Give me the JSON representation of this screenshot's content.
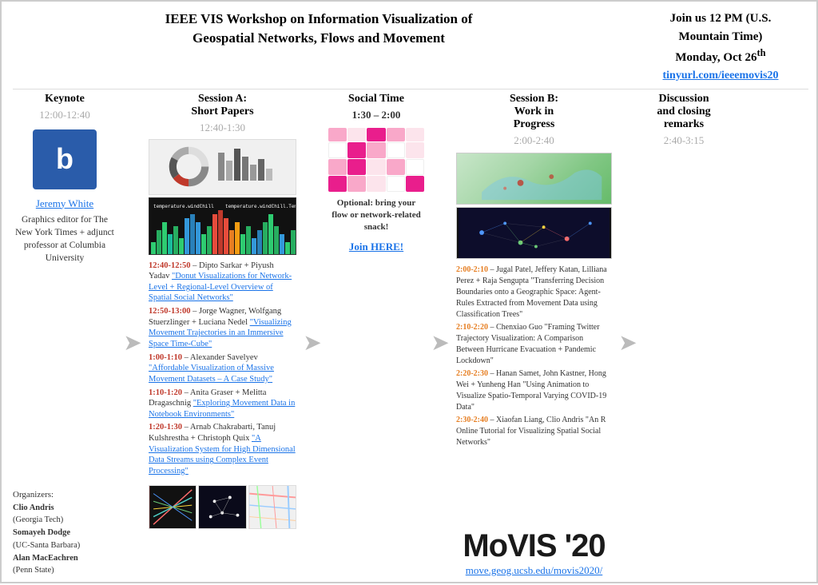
{
  "header": {
    "title_line1": "IEEE VIS Workshop on Information Visualization of",
    "title_line2": "Geospatial Networks, Flows and Movement",
    "join_label": "Join us 12 PM (U.S.",
    "join_time": "Mountain Time)",
    "join_day": "Monday, Oct 26",
    "join_sup": "th",
    "join_url": "tinyurl.com/ieeemovis20"
  },
  "keynote": {
    "label": "Keynote",
    "time": "12:00-12:40",
    "logo_letter": "b",
    "speaker_name": "Jeremy White",
    "speaker_desc": "Graphics editor for The New York Times + adjunct professor at Columbia University"
  },
  "session_a": {
    "label_line1": "Session A:",
    "label_line2": "Short Papers",
    "time": "12:40-1:30",
    "papers": [
      {
        "time": "12:40-12:50",
        "authors": "– Dipto Sarkar + Piyush Yadav",
        "title": "\"Donut Visualizations for Network-Level + Regional-Level Overview of Spatial Social Networks\""
      },
      {
        "time": "12:50-13:00",
        "authors": "– Jorge Wagner, Wolfgang Stuerzlinger + Luciana Nedel",
        "title": "\"Visualizing Movement Trajectories in an Immersive Space Time-Cube\""
      },
      {
        "time": "1:00-1:10",
        "authors": "– Alexander Savelyev",
        "title": "\"Affordable Visualization of Massive Movement Datasets – A Case Study\""
      },
      {
        "time": "1:10-1:20",
        "authors": "– Anita Graser + Melitta Dragaschnig",
        "title": "\"Exploring Movement Data in Notebook Environments\""
      },
      {
        "time": "1:20-1:30",
        "authors": "– Arnab Chakrabarti, Tanuj Kulshrestha + Christoph Quix",
        "title": "\"A Visualization System for High Dimensional Data Streams using Complex Event Processing\""
      }
    ]
  },
  "social": {
    "label": "Social Time",
    "time": "1:30 – 2:00",
    "desc": "Optional: bring your flow or network-related snack!",
    "join_label": "Join HERE!"
  },
  "session_b": {
    "label_line1": "Session B:",
    "label_line2": "Work in",
    "label_line3": "Progress",
    "time": "2:00-2:40",
    "papers": [
      {
        "time": "2:00-2:10",
        "text": "– Jugal Patel, Jeffery Katan, Lilliana Perez + Raja Sengupta \"Transferring Decision Boundaries onto a Geographic Space: Agent-Rules Extracted from Movement Data using Classification Trees\""
      },
      {
        "time": "2:10-2:20",
        "text": "– Chenxiao Guo \"Framing Twitter Trajectory Visualization: A Comparison Between Hurricane Evacuation + Pandemic Lockdown\""
      },
      {
        "time": "2:20-2:30",
        "text": "– Hanan Samet, John Kastner, Hong Wei + Yunheng Han \"Using Animation to Visualize Spatio-Temporal Varying COVID-19 Data\""
      },
      {
        "time": "2:30-2:40",
        "text": "– Xiaofan Liang, Clio Andris \"An R Online Tutorial for Visualizing Spatial Social Networks\""
      }
    ]
  },
  "discussion": {
    "label_line1": "Discussion",
    "label_line2": "and closing",
    "label_line3": "remarks",
    "time": "2:40-3:15"
  },
  "organizers": {
    "title": "Organizers:",
    "people": [
      {
        "name": "Clio Andris",
        "affil": "(Georgia Tech)"
      },
      {
        "name": "Somayeh Dodge",
        "affil": "(UC-Santa Barbara)"
      },
      {
        "name": "Alan MacEachren",
        "affil": "(Penn State)"
      }
    ]
  },
  "movis": {
    "title": "MoVIS '20",
    "url": "move.geog.ucsb.edu/movis2020/"
  }
}
